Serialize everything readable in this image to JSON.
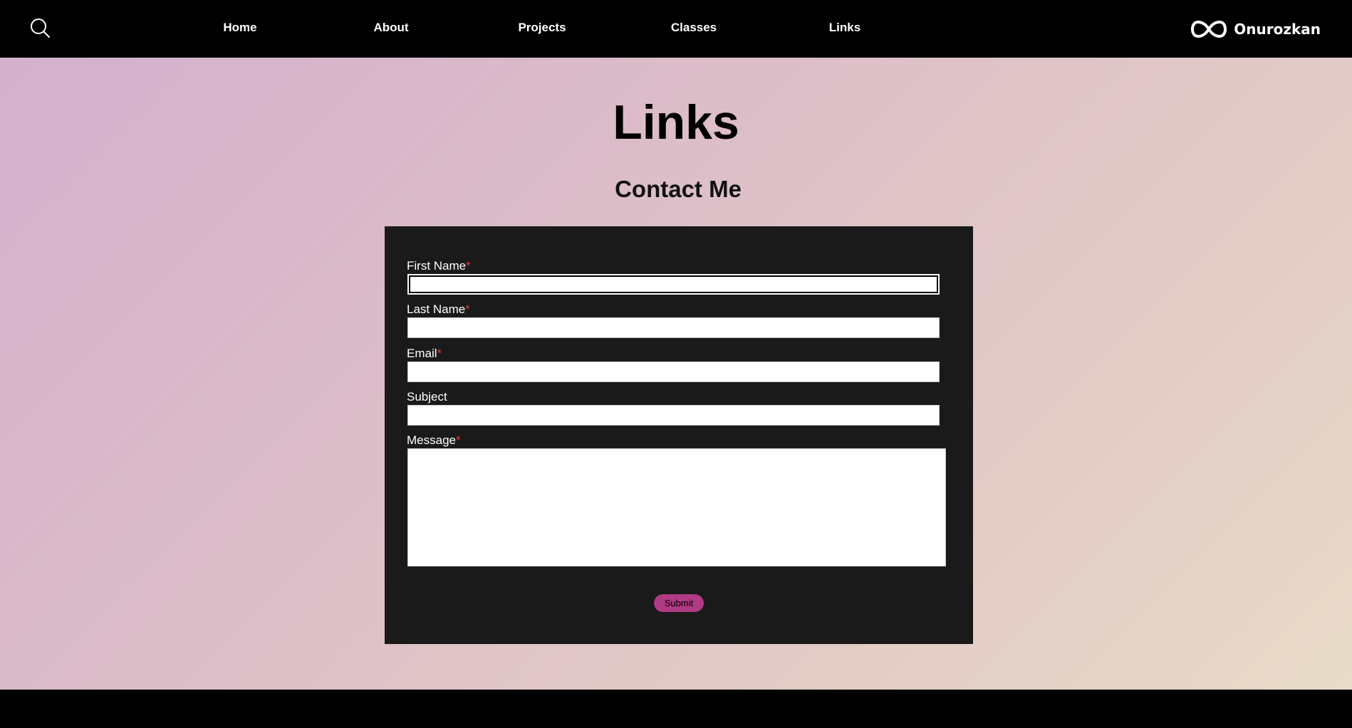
{
  "nav": {
    "items": [
      {
        "label": "Home"
      },
      {
        "label": "About"
      },
      {
        "label": "Projects"
      },
      {
        "label": "Classes"
      },
      {
        "label": "Links"
      }
    ],
    "search_icon": "search-icon"
  },
  "brand": {
    "name": "Onurozkan",
    "logo_icon": "infinity-icon"
  },
  "page": {
    "title": "Links",
    "section_title": "Contact Me"
  },
  "form": {
    "fields": [
      {
        "label": "First Name",
        "required_mark": "*",
        "value": ""
      },
      {
        "label": "Last Name",
        "required_mark": "*",
        "value": ""
      },
      {
        "label": "Email",
        "required_mark": "*",
        "value": ""
      },
      {
        "label": "Subject",
        "required_mark": "",
        "value": ""
      },
      {
        "label": "Message",
        "required_mark": "*",
        "value": ""
      }
    ],
    "submit_label": "Submit"
  },
  "colors": {
    "panel": "#1a1a1a",
    "submit": "#b03a83",
    "required": "#e03a3a",
    "gradient_start": "#d4b0cd",
    "gradient_end": "#e9dbc9"
  }
}
